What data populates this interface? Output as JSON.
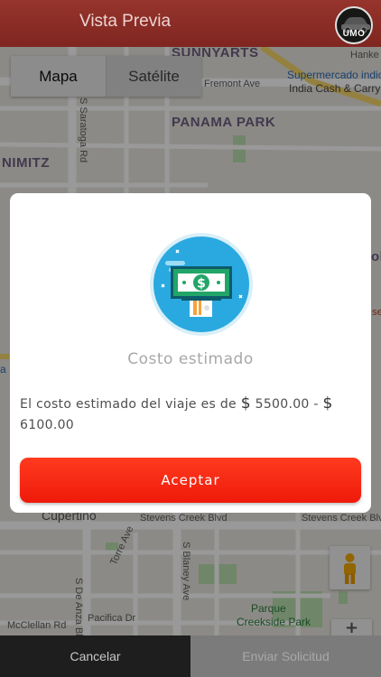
{
  "header": {
    "title": "Vista Previa",
    "logo_text": "UMO"
  },
  "map_type": {
    "map_label": "Mapa",
    "satellite_label": "Satélite"
  },
  "map_labels": {
    "sunnyarts": "SUNNYARTS",
    "fremont_ave": "Fremont Ave",
    "supermercado": "Supermercado indio",
    "india_cash": "India Cash & Carry",
    "hanke": "Hanke",
    "panama_park": "PANAMA PARK",
    "nimitz": "NIMITZ",
    "saratoga_rd": "S Saratoga Rd",
    "cupertino": "Cupertino",
    "stevens_creek_1": "Stevens Creek Blvd",
    "stevens_creek_2": "Stevens Creek Blvd",
    "torre_ave": "Torre Ave",
    "blaney_ave": "S Blaney Ave",
    "de_anza_blvd": "S De Anza Blvd",
    "pacifica_dr": "Pacifica Dr",
    "mcclellan_rd": "McClellan Rd",
    "parque": "Parque",
    "creekside": "Creekside Park",
    "edge_a": "a",
    "edge_ol": "ol",
    "edge_se": "se"
  },
  "modal": {
    "title": "Costo estimado",
    "body_prefix": "El costo estimado del viaje es de",
    "currency_1": "$",
    "amount_1": "5500.00",
    "separator": "-",
    "currency_2": "$",
    "amount_2": "6100.00",
    "accept_label": "Aceptar"
  },
  "bottom_bar": {
    "cancel_label": "Cancelar",
    "send_label": "Enviar Solicitud"
  },
  "colors": {
    "header_red": "#d63a30",
    "accept_red": "#f5250f",
    "icon_circle": "#2aa9e0",
    "money_green": "#22a569"
  }
}
